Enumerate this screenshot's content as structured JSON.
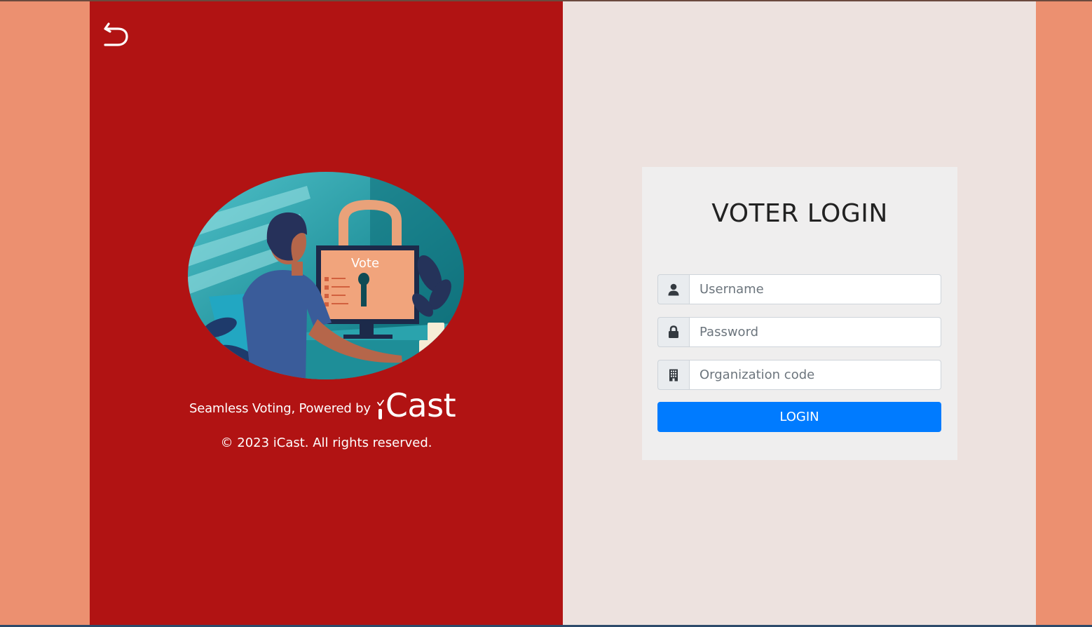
{
  "brand_panel": {
    "back_icon": "undo-arrow-icon",
    "illustration": {
      "screen_text": "Vote"
    },
    "tagline": "Seamless Voting, Powered by",
    "brand_name": "Cast",
    "copyright": "© 2023 iCast. All rights reserved."
  },
  "login": {
    "title": "VOTER LOGIN",
    "username": {
      "placeholder": "Username",
      "icon": "user-icon"
    },
    "password": {
      "placeholder": "Password",
      "icon": "lock-icon"
    },
    "organization": {
      "placeholder": "Organization code",
      "icon": "building-icon"
    },
    "submit_label": "LOGIN"
  },
  "colors": {
    "outer_background": "#ec9070",
    "brand_panel": "#b11313",
    "form_panel": "#ede2df",
    "card": "#efeeee",
    "primary_button": "#007bff"
  }
}
